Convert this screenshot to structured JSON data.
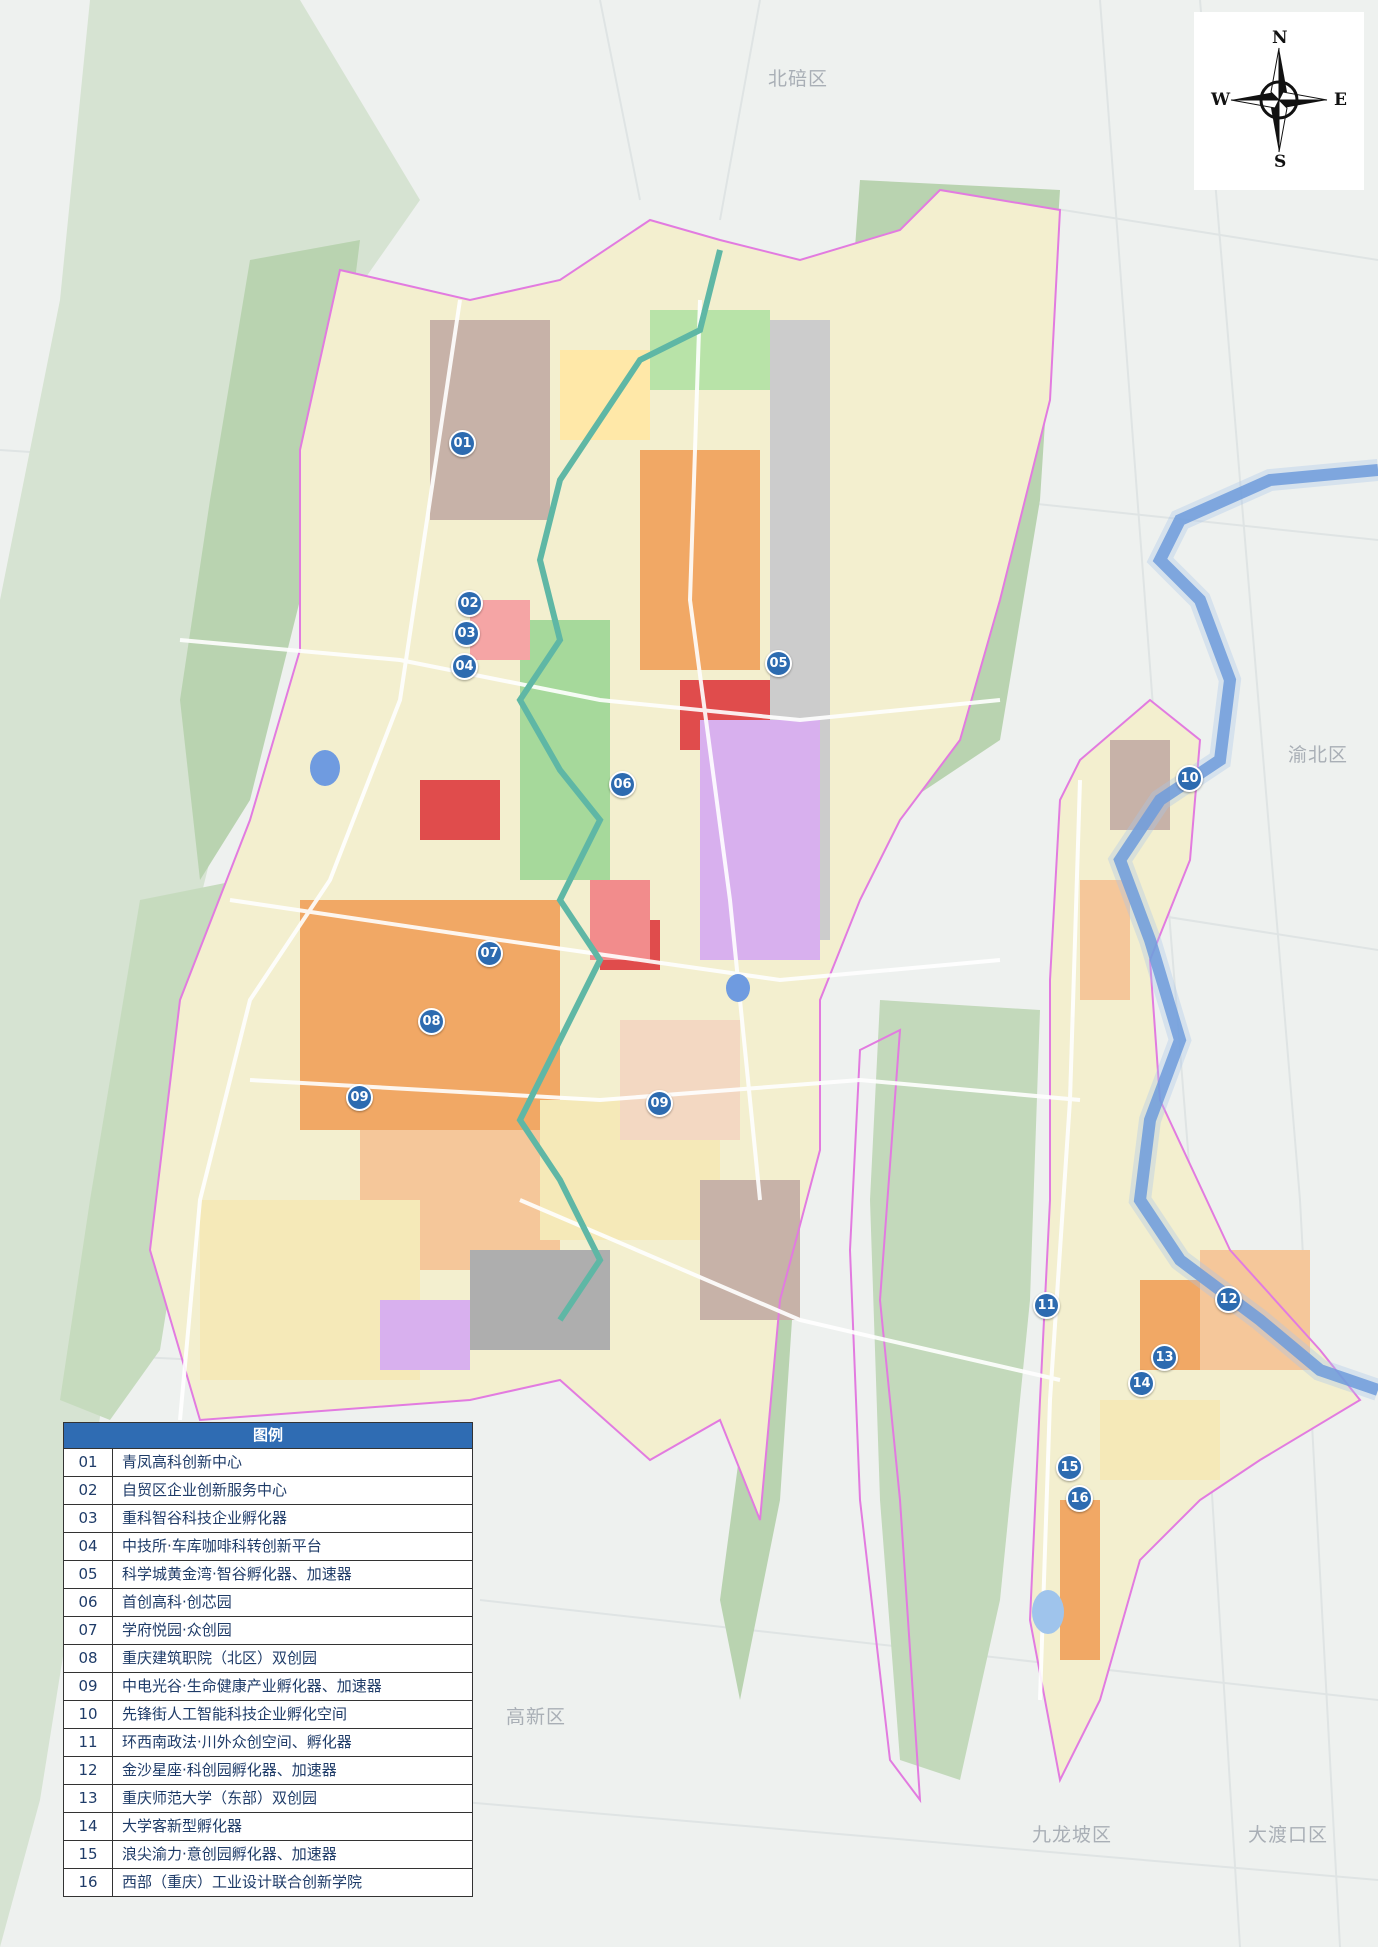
{
  "compass": {
    "north": "N",
    "south": "S",
    "east": "E",
    "west": "W"
  },
  "districts": [
    {
      "id": "beibei",
      "label": "北碚区"
    },
    {
      "id": "yubei",
      "label": "渝北区"
    },
    {
      "id": "gaoxin",
      "label": "高新区"
    },
    {
      "id": "jiulongpo",
      "label": "九龙坡区"
    },
    {
      "id": "dadukou",
      "label": "大渡口区"
    }
  ],
  "markers": [
    {
      "id": "m01",
      "label": "01"
    },
    {
      "id": "m02",
      "label": "02"
    },
    {
      "id": "m03",
      "label": "03"
    },
    {
      "id": "m04",
      "label": "04"
    },
    {
      "id": "m05",
      "label": "05"
    },
    {
      "id": "m06",
      "label": "06"
    },
    {
      "id": "m07",
      "label": "07"
    },
    {
      "id": "m08",
      "label": "08"
    },
    {
      "id": "m09a",
      "label": "09"
    },
    {
      "id": "m09b",
      "label": "09"
    },
    {
      "id": "m10",
      "label": "10"
    },
    {
      "id": "m11",
      "label": "11"
    },
    {
      "id": "m12",
      "label": "12"
    },
    {
      "id": "m13",
      "label": "13"
    },
    {
      "id": "m14",
      "label": "14"
    },
    {
      "id": "m15",
      "label": "15"
    },
    {
      "id": "m16",
      "label": "16"
    }
  ],
  "legend": {
    "title": "图例",
    "items": [
      {
        "num": "01",
        "name": "青凤高科创新中心"
      },
      {
        "num": "02",
        "name": "自贸区企业创新服务中心"
      },
      {
        "num": "03",
        "name": "重科智谷科技企业孵化器"
      },
      {
        "num": "04",
        "name": "中技所·车库咖啡科转创新平台"
      },
      {
        "num": "05",
        "name": "科学城黄金湾·智谷孵化器、加速器"
      },
      {
        "num": "06",
        "name": "首创高科·创芯园"
      },
      {
        "num": "07",
        "name": "学府悦园·众创园"
      },
      {
        "num": "08",
        "name": "重庆建筑职院（北区）双创园"
      },
      {
        "num": "09",
        "name": "中电光谷·生命健康产业孵化器、加速器"
      },
      {
        "num": "10",
        "name": "先锋街人工智能科技企业孵化空间"
      },
      {
        "num": "11",
        "name": "环西南政法·川外众创空间、孵化器"
      },
      {
        "num": "12",
        "name": "金沙星座·科创园孵化器、加速器"
      },
      {
        "num": "13",
        "name": "重庆师范大学（东部）双创园"
      },
      {
        "num": "14",
        "name": "大学客新型孵化器"
      },
      {
        "num": "15",
        "name": "浪尖渝力·意创园孵化器、加速器"
      },
      {
        "num": "16",
        "name": "西部（重庆）工业设计联合创新学院"
      }
    ]
  },
  "colors": {
    "background": "#eef2f0",
    "mountain": "#b9d3b0",
    "boundary": "#e27be0",
    "river": "#4f86d3",
    "marker": "#2d6bb0",
    "legend_header": "#2f6cb3"
  }
}
